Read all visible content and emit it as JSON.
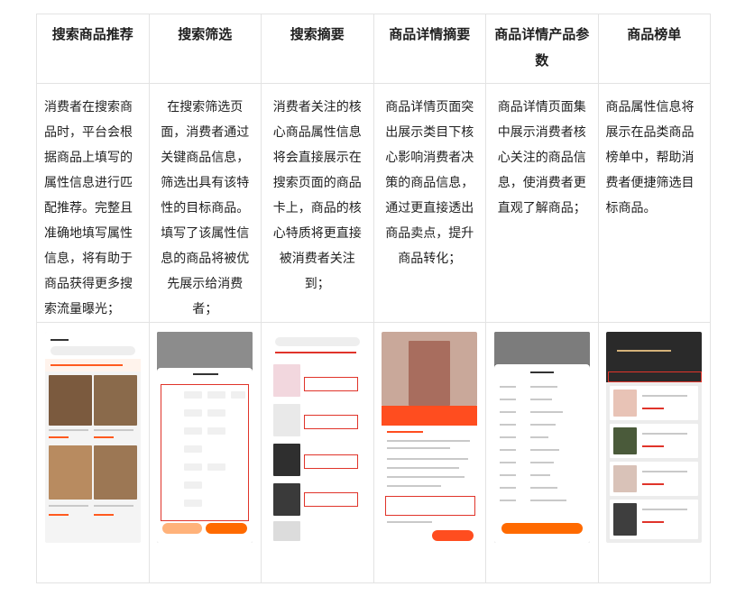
{
  "headers": [
    "搜索商品推荐",
    "搜索筛选",
    "搜索摘要",
    "商品详情摘要",
    "商品详情产品参数",
    "商品榜单"
  ],
  "descriptions": [
    "消费者在搜索商品时，平台会根据商品上填写的属性信息进行匹配推荐。完整且准确地填写属性信息，将有助于商品获得更多搜索流量曝光；",
    "在搜索筛选页面，消费者通过关键商品信息，筛选出具有该特性的目标商品。填写了该属性信息的商品将被优先展示给消费者；",
    "消费者关注的核心商品属性信息将会直接展示在搜索页面的商品卡上，商品的核心特质将更直接被消费者关注到；",
    "商品详情页面突出展示类目下核心影响消费者决策的商品信息，通过更直接透出商品卖点，提升商品转化；",
    "商品详情页面集中展示消费者核心关注的商品信息，使消费者更直观了解商品；",
    "商品属性信息将展示在品类商品榜单中，帮助消费者便捷筛选目标商品。"
  ],
  "shots": [
    {
      "caption": "搜索商品推荐截图",
      "accent": "#ff5a1f"
    },
    {
      "caption": "搜索筛选截图",
      "accent": "#ff6a00"
    },
    {
      "caption": "搜索摘要截图",
      "accent": "#e0342a"
    },
    {
      "caption": "商品详情摘要截图",
      "accent": "#ff4d1f"
    },
    {
      "caption": "商品详情产品参数截图",
      "accent": "#ff6a00"
    },
    {
      "caption": "商品榜单截图",
      "accent": "#2a2a2a"
    }
  ]
}
